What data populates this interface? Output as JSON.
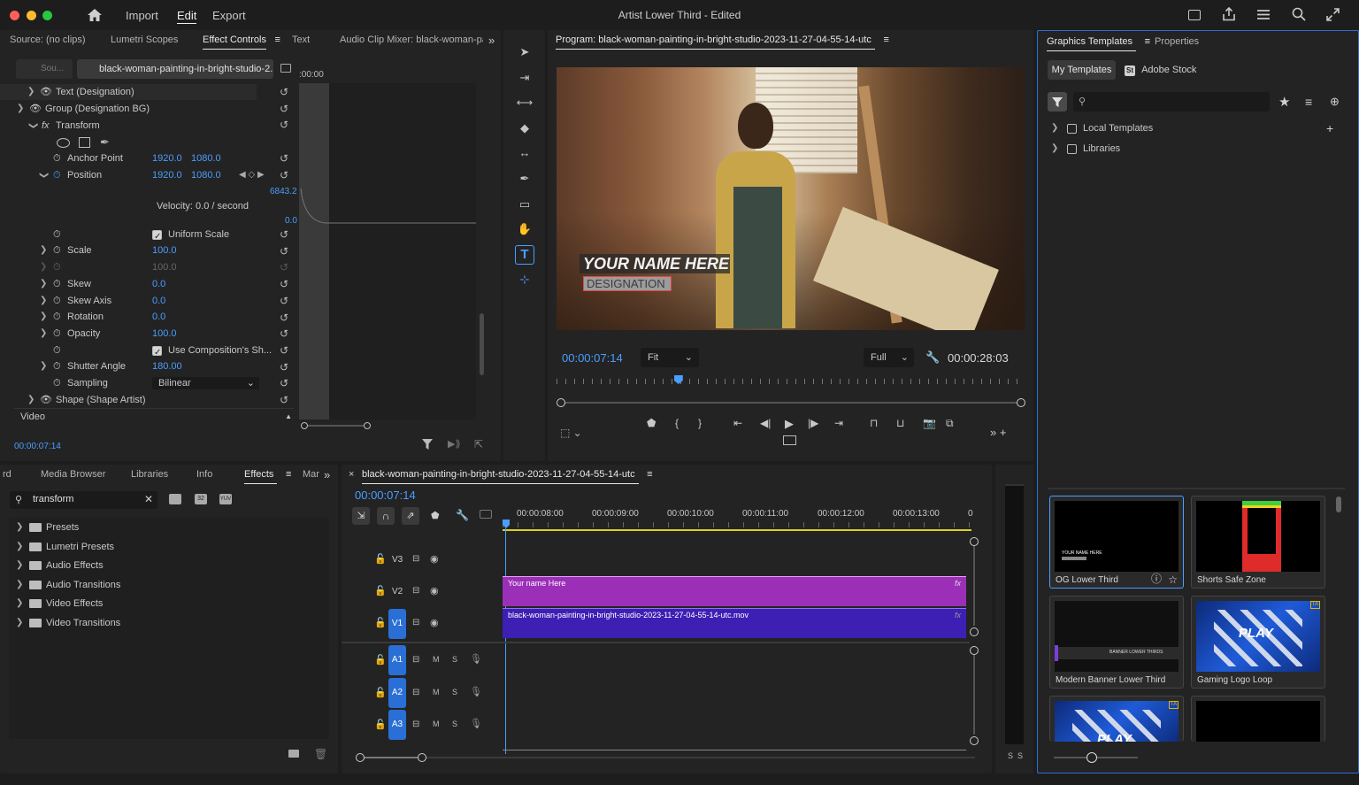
{
  "app": {
    "title": "Artist Lower Third - Edited",
    "menu": [
      "Import",
      "Edit",
      "Export"
    ],
    "active_menu": "Edit"
  },
  "source_panel": {
    "tabs": [
      "Source: (no clips)",
      "Lumetri Scopes",
      "Effect Controls",
      "Text",
      "Audio Clip Mixer: black-woman-paint"
    ],
    "active_tab": "Effect Controls",
    "sub_tabs": [
      "Sou...",
      "black-woman-painting-in-bright-studio-2..."
    ],
    "ruler_time": ":00:00",
    "rows": [
      {
        "label": "Text (Designation)"
      },
      {
        "label": "Group (Designation BG)"
      },
      {
        "label": "Transform"
      },
      {
        "label": "Anchor Point",
        "v1": "1920.0",
        "v2": "1080.0"
      },
      {
        "label": "Position",
        "v1": "1920.0",
        "v2": "1080.0"
      },
      {
        "label": "Uniform Scale"
      },
      {
        "label": "Scale",
        "v1": "100.0"
      },
      {
        "label": "",
        "v1": "100.0"
      },
      {
        "label": "Skew",
        "v1": "0.0"
      },
      {
        "label": "Skew Axis",
        "v1": "0.0"
      },
      {
        "label": "Rotation",
        "v1": "0.0"
      },
      {
        "label": "Opacity",
        "v1": "100.0"
      },
      {
        "label": "Use Composition's Sh..."
      },
      {
        "label": "Shutter Angle",
        "v1": "180.00"
      },
      {
        "label": "Sampling",
        "v1": "Bilinear"
      },
      {
        "label": "Shape (Shape Artist)"
      }
    ],
    "velocity_max": "6843.2",
    "velocity_text": "Velocity: 0.0 / second",
    "velocity_min": "0.0",
    "video_label": "Video",
    "timecode": "00:00:07:14"
  },
  "program": {
    "title": "Program: black-woman-painting-in-bright-studio-2023-11-27-04-55-14-utc",
    "overlay_name": "YOUR NAME HERE",
    "overlay_designation": "DESIGNATION",
    "timecode": "00:00:07:14",
    "fit": "Fit",
    "quality": "Full",
    "duration": "00:00:28:03",
    "playhead_fraction": 0.26
  },
  "graphics": {
    "tabs": [
      "Graphics Templates",
      "Properties"
    ],
    "active_tab": "Graphics Templates",
    "sub_tabs": [
      "My Templates",
      "Adobe Stock"
    ],
    "tree": [
      "Local Templates",
      "Libraries"
    ],
    "templates": [
      {
        "name": "OG Lower Third",
        "text": "YOUR NAME HERE"
      },
      {
        "name": "Shorts Safe Zone"
      },
      {
        "name": "Modern Banner Lower Third",
        "text": "BANNER LOWER THIRDS"
      },
      {
        "name": "Gaming Logo Loop",
        "text": "PLAY"
      },
      {
        "name": "",
        "text": "PLAY"
      },
      {
        "name": ""
      }
    ]
  },
  "project": {
    "tabs": [
      "rd",
      "Media Browser",
      "Libraries",
      "Info",
      "Effects",
      "Mar"
    ],
    "active_tab": "Effects",
    "search_value": "transform",
    "items": [
      "Presets",
      "Lumetri Presets",
      "Audio Effects",
      "Audio Transitions",
      "Video Effects",
      "Video Transitions"
    ]
  },
  "timeline": {
    "sequence": "black-woman-painting-in-bright-studio-2023-11-27-04-55-14-utc",
    "timecode": "00:00:07:14",
    "ruler": [
      "00:00:08:00",
      "00:00:09:00",
      "00:00:10:00",
      "00:00:11:00",
      "00:00:12:00",
      "00:00:13:00",
      "0"
    ],
    "tracks_video": [
      "V3",
      "V2",
      "V1"
    ],
    "tracks_audio": [
      "A1",
      "A2",
      "A3"
    ],
    "clips": [
      {
        "track": "V2",
        "name": "Your name Here",
        "color": "#9b2fb8"
      },
      {
        "track": "V1",
        "name": "black-woman-painting-in-bright-studio-2023-11-27-04-55-14-utc.mov",
        "color": "#3d1fb4"
      }
    ],
    "audio_meter_labels": [
      "S",
      "S"
    ]
  },
  "colors": {
    "accent": "#2a6fd6",
    "timecode_blue": "#4a9eff",
    "clip_v2": "#9b2fb8",
    "clip_v1": "#3d1fb4"
  }
}
